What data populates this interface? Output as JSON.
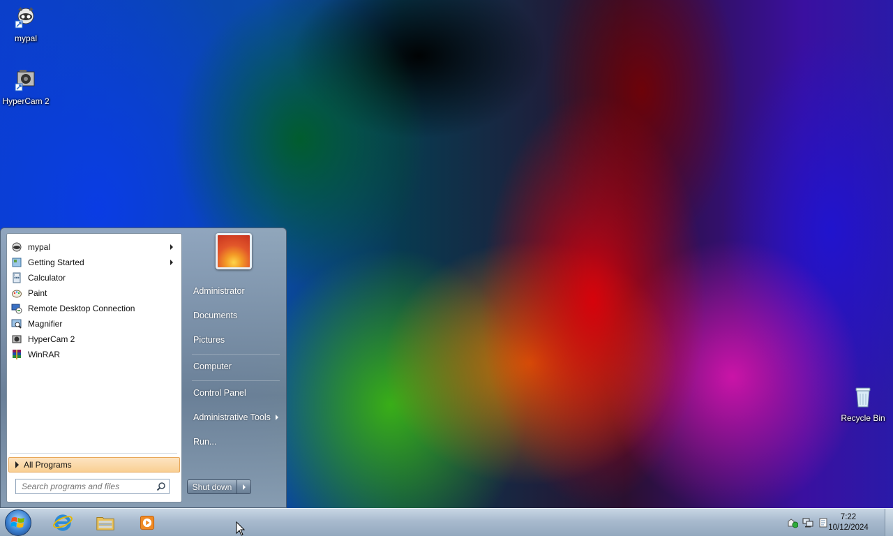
{
  "desktop": {
    "icons": [
      {
        "label": "mypal"
      },
      {
        "label": "HyperCam 2"
      },
      {
        "label": "Recycle Bin"
      }
    ]
  },
  "start_menu": {
    "programs": [
      {
        "label": "mypal",
        "has_submenu": true,
        "icon": "mypal-icon"
      },
      {
        "label": "Getting Started",
        "has_submenu": true,
        "icon": "getting-started-icon"
      },
      {
        "label": "Calculator",
        "has_submenu": false,
        "icon": "calculator-icon"
      },
      {
        "label": "Paint",
        "has_submenu": false,
        "icon": "paint-icon"
      },
      {
        "label": "Remote Desktop Connection",
        "has_submenu": false,
        "icon": "remote-desktop-icon"
      },
      {
        "label": "Magnifier",
        "has_submenu": false,
        "icon": "magnifier-icon"
      },
      {
        "label": "HyperCam 2",
        "has_submenu": false,
        "icon": "hypercam-icon"
      },
      {
        "label": "WinRAR",
        "has_submenu": false,
        "icon": "winrar-icon"
      }
    ],
    "all_programs": "All Programs",
    "search": {
      "placeholder": "Search programs and files",
      "value": ""
    },
    "right": {
      "user": "Administrator",
      "documents": "Documents",
      "pictures": "Pictures",
      "computer": "Computer",
      "control_panel": "Control Panel",
      "admin_tools": "Administrative Tools",
      "run": "Run..."
    },
    "shutdown": "Shut down"
  },
  "taskbar": {
    "pinned": [
      "internet-explorer-icon",
      "windows-explorer-icon",
      "media-player-icon"
    ],
    "clock": {
      "time": "7:22",
      "date": "10/12/2024"
    }
  },
  "colors": {
    "highlight": "#f9cf93",
    "taskbar": "#a8bace"
  }
}
